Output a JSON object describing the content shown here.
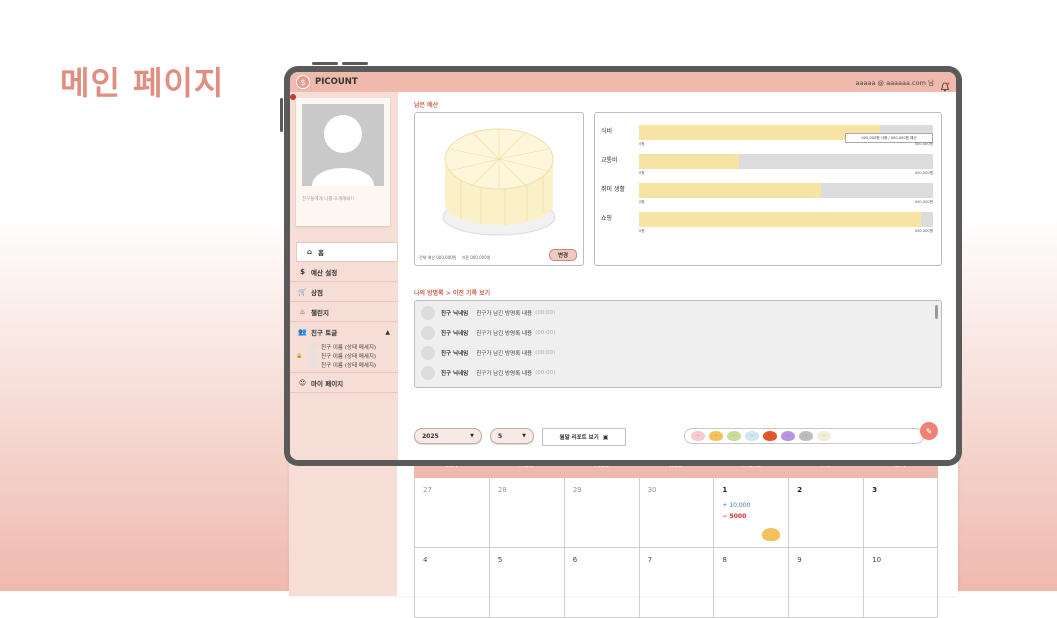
{
  "slide": {
    "title": "메인 페이지"
  },
  "header": {
    "app_name": "PICOUNT",
    "logo_glyph": "$",
    "user": "aaaaa @ aaaaaa.com 님"
  },
  "sidebar": {
    "profile_caption": "친구들에게 나를 소개해봐!!",
    "items": [
      {
        "label": "홈",
        "icon": "home-icon",
        "glyph": "⌂"
      },
      {
        "label": "예산 설정",
        "icon": "dollar-icon",
        "glyph": "$"
      },
      {
        "label": "상점",
        "icon": "cart-icon",
        "glyph": "🛒"
      },
      {
        "label": "챌린지",
        "icon": "fire-icon",
        "glyph": "♨"
      },
      {
        "label": "친구 토글",
        "icon": "friends-icon",
        "glyph": "👥",
        "expanded": true
      },
      {
        "label": "마이 페이지",
        "icon": "user-icon",
        "glyph": "☺"
      }
    ],
    "friends": [
      {
        "label": "친구 이름 (상태 메세지)",
        "locked": false
      },
      {
        "label": "친구 이름 (상태 메세지)",
        "locked": true
      },
      {
        "label": "친구 이름 (상태 메세지)",
        "locked": false
      }
    ]
  },
  "budget": {
    "title": "남은 예산",
    "total_label": "전체 예산 000,000원",
    "remaining_label": "이용 000,000원",
    "change_button": "변경"
  },
  "categories": [
    {
      "label": "식비",
      "fill": 0.82,
      "min": "0원",
      "max": "000,000원",
      "tooltip": "000,000원 사용 / 000,000원 예산"
    },
    {
      "label": "교통비",
      "fill": 0.34,
      "min": "0원",
      "max": "000,000원"
    },
    {
      "label": "취미 생활",
      "fill": 0.62,
      "min": "0원",
      "max": "000,000원"
    },
    {
      "label": "쇼핑",
      "fill": 0.96,
      "min": "0원",
      "max": "000,000원"
    }
  ],
  "guestbook": {
    "title": "나의 방명록 > 이전 기록 보기",
    "rows": [
      {
        "name": "친구 닉네임",
        "message": "친구가 남긴 방명록 내용",
        "time": "(00:00)"
      },
      {
        "name": "친구 닉네임",
        "message": "친구가 남긴 방명록 내용",
        "time": "(00:00)"
      },
      {
        "name": "친구 닉네임",
        "message": "친구가 남긴 방명록 내용",
        "time": "(00:00)"
      },
      {
        "name": "친구 닉네임",
        "message": "친구가 남긴 방명록 내용",
        "time": "(00:00)"
      }
    ]
  },
  "controls": {
    "year": "2025",
    "month": "5",
    "report_button": "월말 리포트 보기",
    "emotions": [
      "#f6c9d2",
      "#f3c25f",
      "#c8dc9a",
      "#cfe6ef",
      "#e0562d",
      "#b896de",
      "#bdbdbd",
      "#efeed8"
    ]
  },
  "calendar": {
    "days": [
      "SUN",
      "MON",
      "TUES",
      "WED",
      "THURS",
      "FRI",
      "SAT"
    ],
    "week1": [
      "27",
      "28",
      "29",
      "30",
      "1",
      "2",
      "3"
    ],
    "week2": [
      "4",
      "5",
      "6",
      "7",
      "8",
      "9",
      "10"
    ],
    "income": "+ 10,000",
    "expense": "− 5000"
  },
  "colors": {
    "accent": "#efb9ae",
    "title": "#e08e80",
    "section": "#d2614f",
    "bar": "#f7e3a3"
  }
}
